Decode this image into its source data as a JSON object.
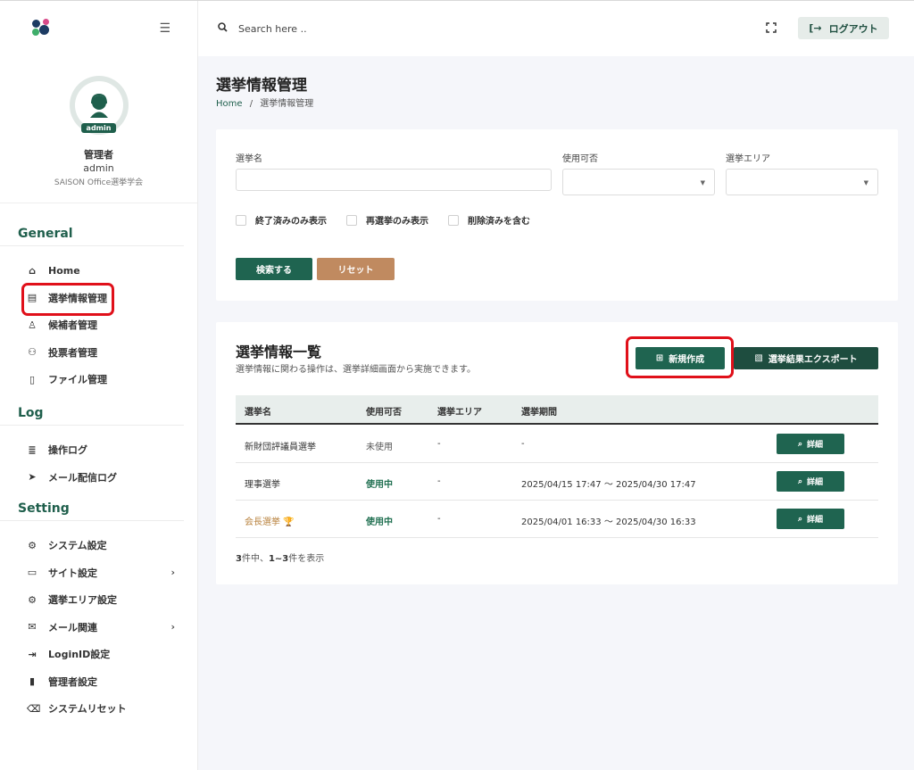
{
  "topbar": {
    "search_placeholder": "Search here ..",
    "logout_label": "ログアウト"
  },
  "profile": {
    "badge": "admin",
    "name": "管理者",
    "role": "admin",
    "org": "SAISON Office選挙学会"
  },
  "sidebar": {
    "sections": [
      {
        "title": "General",
        "items": [
          {
            "label": "Home",
            "icon": "home-icon"
          },
          {
            "label": "選挙情報管理",
            "icon": "archive-icon"
          },
          {
            "label": "候補者管理",
            "icon": "user-check-icon"
          },
          {
            "label": "投票者管理",
            "icon": "users-icon"
          },
          {
            "label": "ファイル管理",
            "icon": "file-icon"
          }
        ]
      },
      {
        "title": "Log",
        "items": [
          {
            "label": "操作ログ",
            "icon": "database-icon"
          },
          {
            "label": "メール配信ログ",
            "icon": "send-icon"
          }
        ]
      },
      {
        "title": "Setting",
        "items": [
          {
            "label": "システム設定",
            "icon": "gear-icon"
          },
          {
            "label": "サイト設定",
            "icon": "monitor-icon"
          },
          {
            "label": "選挙エリア設定",
            "icon": "gear-icon"
          },
          {
            "label": "メール関連",
            "icon": "mail-icon"
          },
          {
            "label": "LoginID設定",
            "icon": "login-icon"
          },
          {
            "label": "管理者設定",
            "icon": "clipboard-icon"
          },
          {
            "label": "システムリセット",
            "icon": "delete-icon"
          }
        ]
      }
    ]
  },
  "page": {
    "title": "選挙情報管理",
    "breadcrumb_home": "Home",
    "breadcrumb_sep": "/",
    "breadcrumb_current": "選挙情報管理"
  },
  "filters": {
    "name_label": "選挙名",
    "usage_label": "使用可否",
    "area_label": "選挙エリア",
    "check_ended": "終了済みのみ表示",
    "check_reelection": "再選挙のみ表示",
    "check_deleted": "削除済みを含む",
    "search_button": "検索する",
    "reset_button": "リセット"
  },
  "list": {
    "title": "選挙情報一覧",
    "subtitle": "選挙情報に関わる操作は、選挙詳細画面から実施できます。",
    "new_button": "新規作成",
    "export_button": "選挙結果エクスポート",
    "columns": [
      "選挙名",
      "使用可否",
      "選挙エリア",
      "選挙期間"
    ],
    "rows": [
      {
        "name": "新財団評議員選挙",
        "status": "未使用",
        "area": "-",
        "period": "-",
        "detail": "詳細"
      },
      {
        "name": "理事選挙",
        "status": "使用中",
        "area": "-",
        "period": "2025/04/15 17:47 〜 2025/04/30 17:47",
        "detail": "詳細"
      },
      {
        "name": "会長選挙",
        "status": "使用中",
        "area": "-",
        "period": "2025/04/01 16:33 〜 2025/04/30 16:33",
        "detail": "詳細"
      }
    ],
    "count_total": "3",
    "count_mid": "件中、",
    "count_range": "1~3",
    "count_suffix": "件を表示"
  }
}
